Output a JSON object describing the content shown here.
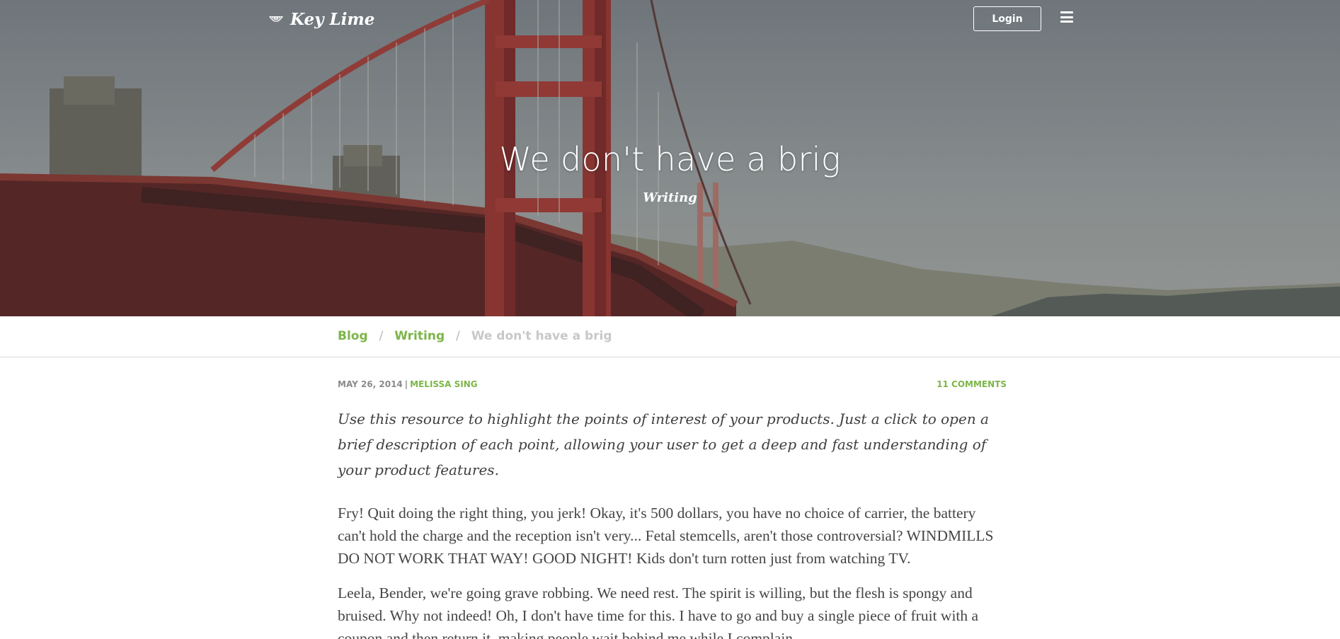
{
  "header": {
    "logo_text": "Key Lime",
    "logo_icon": "lime-slice-icon",
    "login_label": "Login",
    "menu_icon": "hamburger-menu-icon"
  },
  "hero": {
    "title": "We don't have a brig",
    "category": "Writing"
  },
  "breadcrumb": {
    "items": [
      {
        "label": "Blog"
      },
      {
        "label": "Writing"
      },
      {
        "label": "We don't have a brig"
      }
    ],
    "separator": "/"
  },
  "post": {
    "date": "MAY 26, 2014",
    "meta_separator": "|",
    "author": "MELISSA SING",
    "comments": "11 COMMENTS",
    "lead": "Use this resource to highlight the points of interest of your products. Just a click to open a brief description of each point, allowing your user to get a deep and fast understanding of your product features.",
    "paragraphs": [
      "Fry! Quit doing the right thing, you jerk! Okay, it's 500 dollars, you have no choice of carrier, the battery can't hold the charge and the reception isn't very... Fetal stemcells, aren't those controversial? WINDMILLS DO NOT WORK THAT WAY! GOOD NIGHT! Kids don't turn rotten just from watching TV.",
      "Leela, Bender, we're going grave robbing. We need rest. The spirit is willing, but the flesh is spongy and bruised. Why not indeed! Oh, I don't have time for this. I have to go and buy a single piece of fruit with a coupon and then return it, making people wait behind me while I complain."
    ]
  },
  "colors": {
    "accent": "#7cb548",
    "bridge_red": "#b23a34",
    "muted_text": "#8a8a8a"
  }
}
